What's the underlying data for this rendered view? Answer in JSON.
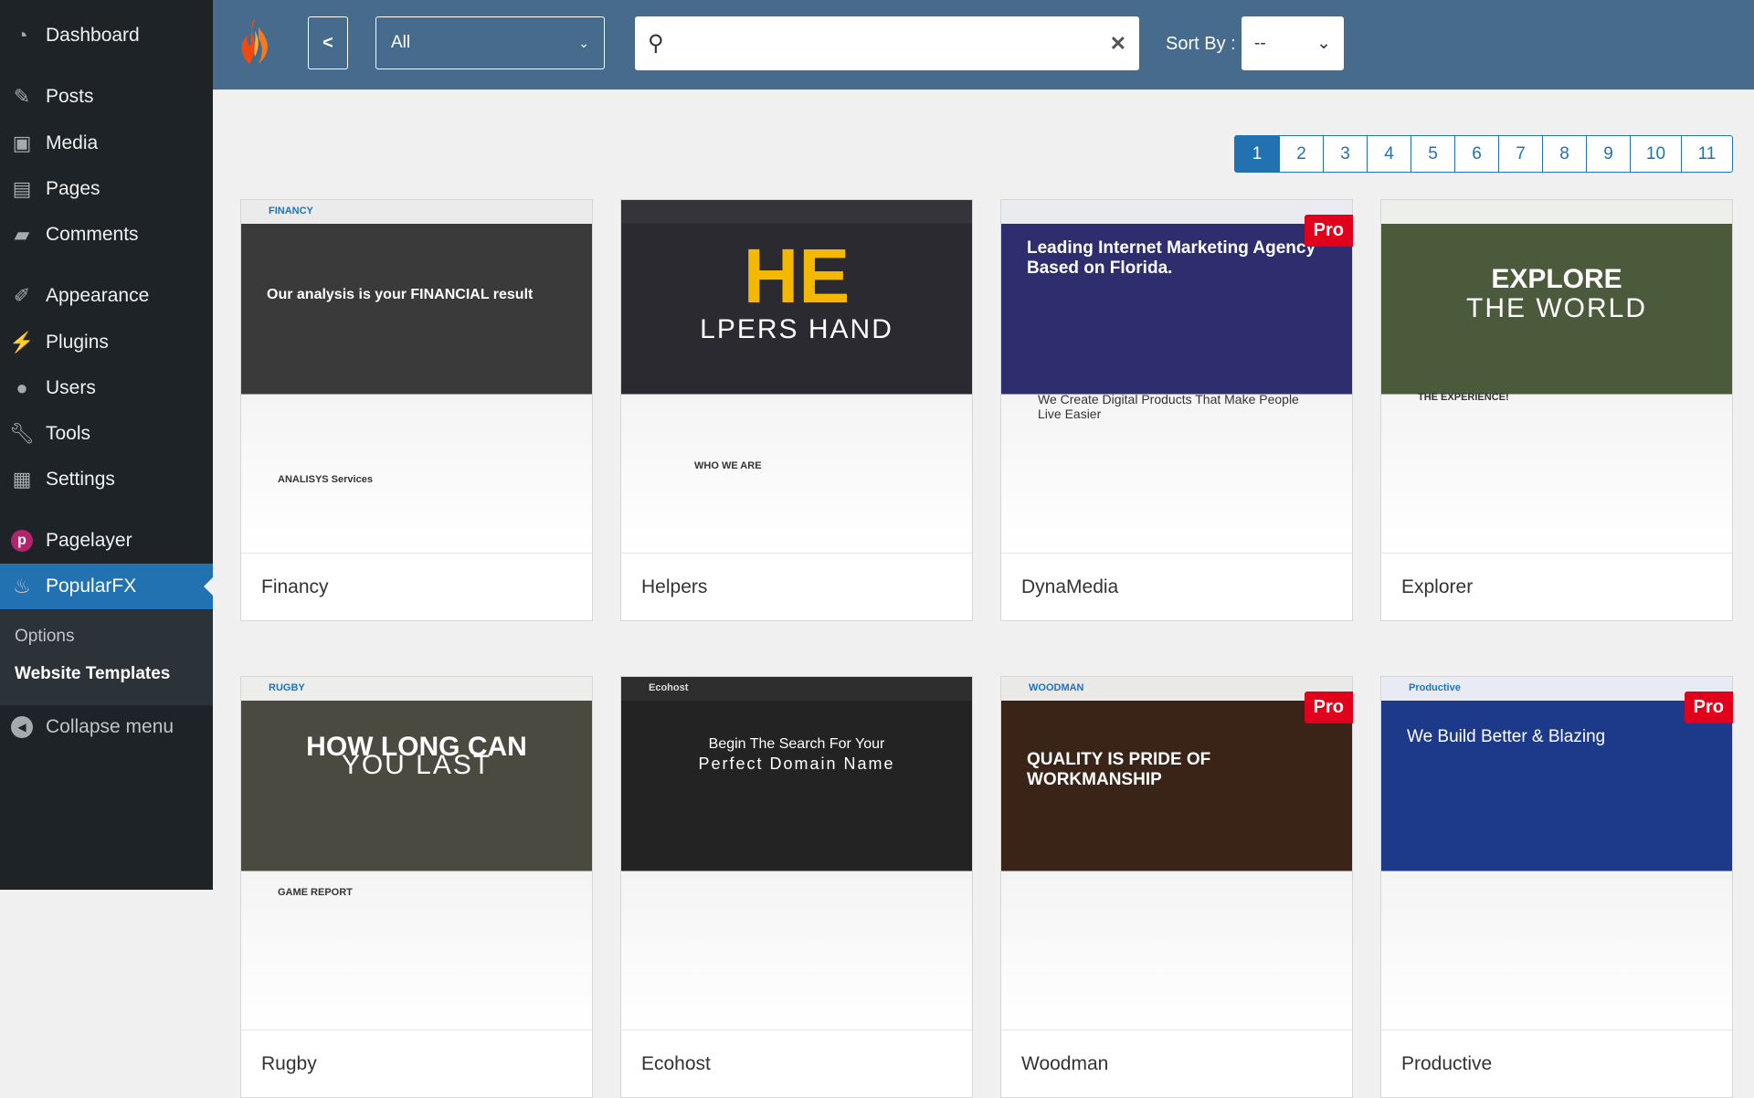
{
  "sidebar": {
    "items": [
      {
        "label": "Dashboard",
        "icon": "dashboard-icon"
      },
      {
        "label": "Posts",
        "icon": "pin-icon"
      },
      {
        "label": "Media",
        "icon": "media-icon"
      },
      {
        "label": "Pages",
        "icon": "pages-icon"
      },
      {
        "label": "Comments",
        "icon": "comment-icon"
      },
      {
        "label": "Appearance",
        "icon": "brush-icon"
      },
      {
        "label": "Plugins",
        "icon": "plugin-icon"
      },
      {
        "label": "Users",
        "icon": "user-icon"
      },
      {
        "label": "Tools",
        "icon": "wrench-icon"
      },
      {
        "label": "Settings",
        "icon": "settings-icon"
      },
      {
        "label": "Pagelayer",
        "icon": "pagelayer-icon"
      },
      {
        "label": "PopularFX",
        "icon": "popularfx-icon"
      }
    ],
    "submenu": [
      "Options",
      "Website Templates"
    ],
    "collapse": "Collapse menu"
  },
  "header": {
    "back": "<",
    "category": "All",
    "search_value": "",
    "clear": "✕",
    "sort_label": "Sort By :",
    "sort_value": "--"
  },
  "pagination": [
    "1",
    "2",
    "3",
    "4",
    "5",
    "6",
    "7",
    "8",
    "9",
    "10",
    "11"
  ],
  "current_page": "1",
  "templates": [
    {
      "name": "Financy",
      "pro": false,
      "headline": "Our analysis is your FINANCIAL result",
      "bg": "#3a3a3a",
      "brand": "FINANCY",
      "sub": "ANALISYS Services"
    },
    {
      "name": "Helpers",
      "pro": false,
      "headline": "HE",
      "headline2": "LPERS HAND",
      "bg": "#2a2a30",
      "sub": "WHO WE ARE"
    },
    {
      "name": "DynaMedia",
      "pro": true,
      "headline": "Leading Internet Marketing Agency Based on Florida.",
      "bg": "#2e2e6e",
      "sub": "We Create Digital Products That Make People Live Easier"
    },
    {
      "name": "Explorer",
      "pro": false,
      "headline": "EXPLORE",
      "headline2": "THE WORLD",
      "bg": "#4a5a3a",
      "sub": "THE EXPERIENCE!"
    },
    {
      "name": "Rugby",
      "pro": false,
      "headline": "HOW LONG CAN",
      "headline2": "YOU LAST",
      "bg": "#4a4a40",
      "brand": "RUGBY",
      "sub": "GAME REPORT"
    },
    {
      "name": "Ecohost",
      "pro": false,
      "headline": "Begin The Search For Your",
      "headline2": "Perfect Domain Name",
      "bg": "#232323",
      "brand": "Ecohost"
    },
    {
      "name": "Woodman",
      "pro": true,
      "headline": "QUALITY IS PRIDE OF WORKMANSHIP",
      "bg": "#3a2418",
      "brand": "WOODMAN"
    },
    {
      "name": "Productive",
      "pro": true,
      "headline": "We Build Better & Blazing",
      "bg": "#1d3a8a",
      "brand": "Productive"
    }
  ],
  "pro_label": "Pro",
  "colors": {
    "accent": "#2271b1",
    "header": "#466b8c",
    "pro": "#e0001b",
    "sidebar": "#1d2327"
  }
}
